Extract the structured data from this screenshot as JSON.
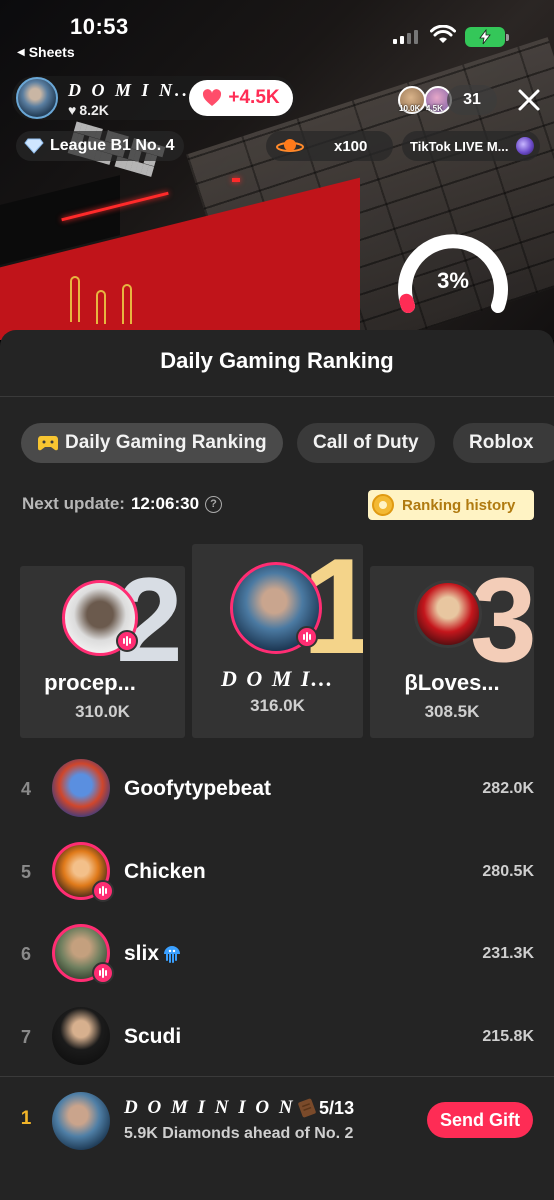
{
  "status_bar": {
    "time": "10:53",
    "back_app": "Sheets"
  },
  "live_header": {
    "host_name": "D O M I N...",
    "host_likes": "8.2K",
    "gain": "+4.5K",
    "viewer_amounts": [
      "10.0K",
      "4.5K"
    ],
    "viewer_count": "31",
    "league": "League B1 No. 4",
    "gift_count": "x100",
    "live_label": "TikTok LIVE M...",
    "progress_label": "3%",
    "progress_value": 0.03
  },
  "sheet": {
    "title": "Daily Gaming Ranking",
    "tabs": [
      {
        "label": "Daily Gaming Ranking",
        "active": true
      },
      {
        "label": "Call of Duty",
        "active": false
      },
      {
        "label": "Roblox",
        "active": false
      }
    ],
    "next_update_label": "Next update:",
    "next_update_value": "12:06:30",
    "history_label": "Ranking history",
    "podium": [
      {
        "rank": "2",
        "name": "procep...",
        "score": "310.0K"
      },
      {
        "rank": "1",
        "name": "D O M I...",
        "score": "316.0K"
      },
      {
        "rank": "3",
        "name": "βLoves...",
        "score": "308.5K"
      }
    ],
    "rows": [
      {
        "rank": "4",
        "name": "Goofytypebeat",
        "score": "282.0K"
      },
      {
        "rank": "5",
        "name": "Chicken",
        "score": "280.5K"
      },
      {
        "rank": "6",
        "name": "slix",
        "score": "231.3K"
      },
      {
        "rank": "7",
        "name": "Scudi",
        "score": "215.8K"
      }
    ],
    "me": {
      "rank": "1",
      "name": "D O M I N I O N",
      "count": "5/13",
      "sub": "5.9K Diamonds ahead of No. 2",
      "button": "Send Gift"
    }
  },
  "colors": {
    "accent": "#fe2c55",
    "live_ring": "#ff2d73",
    "gold": "#f0b429",
    "sheet_bg": "#242424",
    "card_bg": "#333333"
  }
}
